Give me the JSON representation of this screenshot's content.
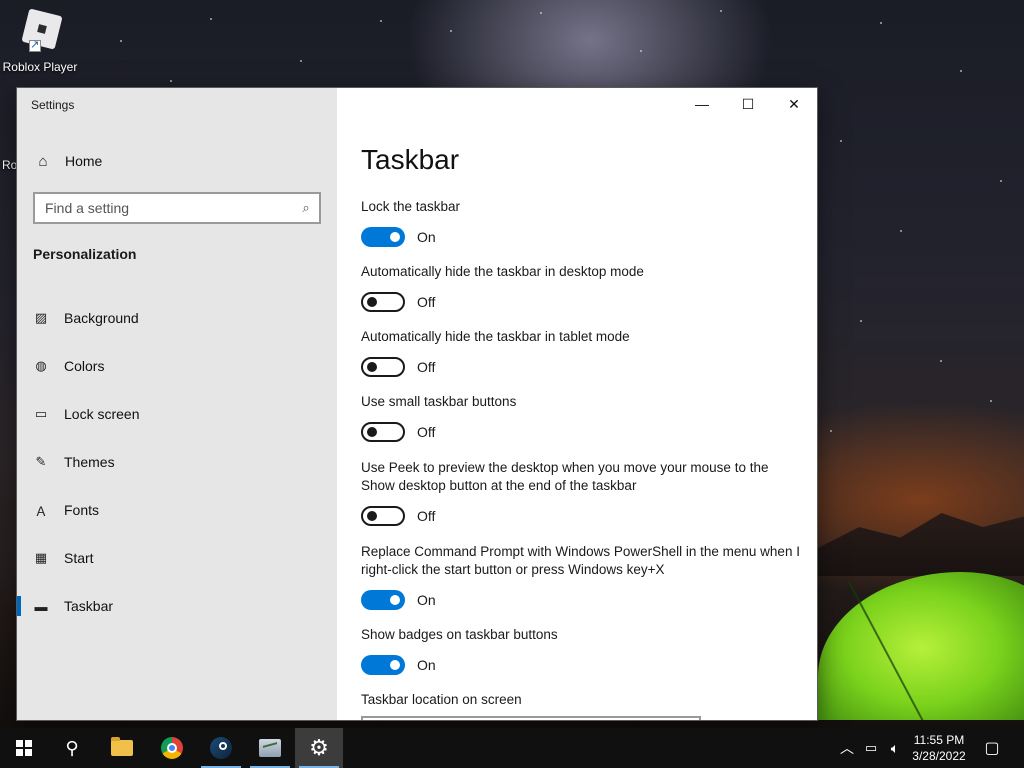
{
  "desktop": {
    "icon_label": "Roblox Player",
    "ghost_label_1": "Ro"
  },
  "window": {
    "title": "Settings",
    "caption": {
      "minimize_glyph": "—",
      "maximize_glyph": "☐",
      "close_glyph": "✕"
    }
  },
  "sidebar": {
    "home_label": "Home",
    "search_placeholder": "Find a setting",
    "section": "Personalization",
    "items": [
      {
        "label": "Background",
        "icon": "image-icon"
      },
      {
        "label": "Colors",
        "icon": "palette-icon"
      },
      {
        "label": "Lock screen",
        "icon": "lock-screen-icon"
      },
      {
        "label": "Themes",
        "icon": "brush-icon"
      },
      {
        "label": "Fonts",
        "icon": "font-icon"
      },
      {
        "label": "Start",
        "icon": "start-layout-icon"
      },
      {
        "label": "Taskbar",
        "icon": "taskbar-icon",
        "active": true
      }
    ]
  },
  "main": {
    "title": "Taskbar",
    "settings": [
      {
        "label": "Lock the taskbar",
        "state": "On"
      },
      {
        "label": "Automatically hide the taskbar in desktop mode",
        "state": "Off"
      },
      {
        "label": "Automatically hide the taskbar in tablet mode",
        "state": "Off"
      },
      {
        "label": "Use small taskbar buttons",
        "state": "Off"
      },
      {
        "label": "Use Peek to preview the desktop when you move your mouse to the Show desktop button at the end of the taskbar",
        "state": "Off"
      },
      {
        "label": "Replace Command Prompt with Windows PowerShell in the menu when I right-click the start button or press Windows key+X",
        "state": "On"
      },
      {
        "label": "Show badges on taskbar buttons",
        "state": "On"
      }
    ],
    "location_label": "Taskbar location on screen"
  },
  "taskbar": {
    "clock_time": "11:55 PM",
    "clock_date": "3/28/2022"
  },
  "colors": {
    "accent": "#0078d7",
    "sidebar_bg": "#e6e6e6",
    "taskbar_bg": "#101010"
  }
}
